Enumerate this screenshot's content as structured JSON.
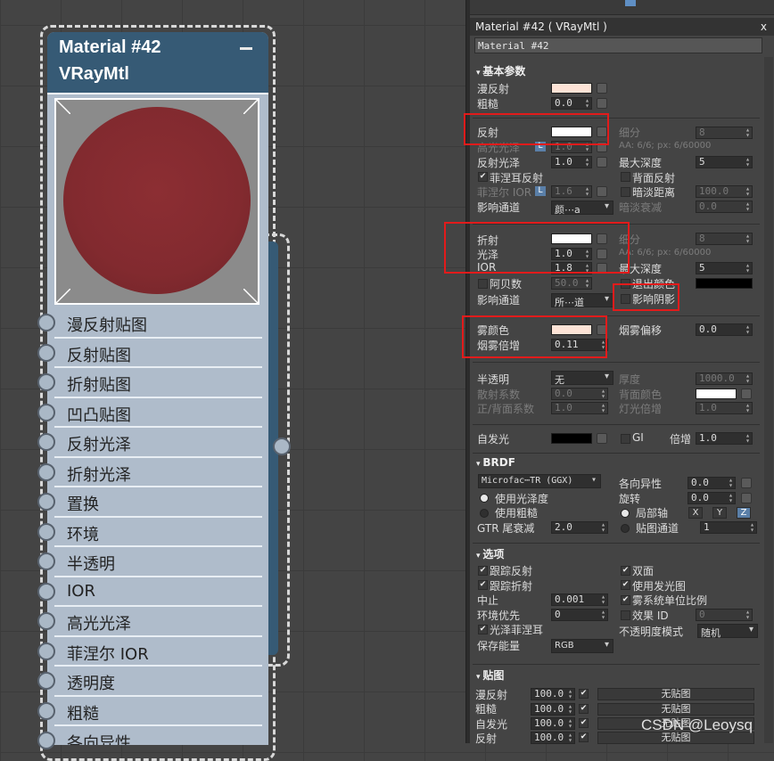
{
  "node": {
    "title_line1": "Material #42",
    "title_line2": "VRayMtl",
    "slots": [
      "漫反射贴图",
      "反射贴图",
      "折射贴图",
      "凹凸贴图",
      "反射光泽",
      "折射光泽",
      "置换",
      "环境",
      "半透明",
      "IOR",
      "高光光泽",
      "菲涅尔 IOR",
      "透明度",
      "粗糙",
      "各向异性"
    ]
  },
  "panel": {
    "title": "Material #42  ( VRayMtl )",
    "close": "x",
    "name_value": "Material #42",
    "basic": {
      "header": "基本参数",
      "diffuse": "漫反射",
      "rough": "粗糙",
      "rough_val": "0.0",
      "reflect": "反射",
      "subdiv": "细分",
      "subdiv_val": "8",
      "aa": "AA: 6/6; px: 6/60000",
      "hilight_gloss": "高光光泽",
      "hilight_val": "1.0",
      "refl_gloss": "反射光泽",
      "refl_gloss_val": "1.0",
      "max_depth": "最大深度",
      "max_depth_val": "5",
      "fresnel": "菲涅耳反射",
      "back_reflect": "背面反射",
      "fresnel_ior": "菲涅尔 IOR",
      "fresnel_ior_val": "1.6",
      "dim_dist": "暗淡距离",
      "dim_dist_val": "100.0",
      "affect_channel": "影响通道",
      "affect_channel_val": "颜⋯a",
      "dim_falloff": "暗淡衰减",
      "dim_falloff_val": "0.0",
      "refract": "折射",
      "refr_subdiv": "细分",
      "refr_subdiv_val": "8",
      "refr_aa": "AA: 6/6; px: 6/60000",
      "gloss": "光泽",
      "gloss_val": "1.0",
      "ior": "IOR",
      "ior_val": "1.8",
      "refr_max_depth": "最大深度",
      "refr_max_depth_val": "5",
      "abbe": "阿贝数",
      "abbe_val": "50.0",
      "exit_color": "退出颜色",
      "refr_affect": "影响通道",
      "refr_affect_val": "所⋯道",
      "affect_shadow": "影响阴影",
      "fog_color": "雾颜色",
      "fog_bias": "烟雾偏移",
      "fog_bias_val": "0.0",
      "fog_mult": "烟雾倍增",
      "fog_mult_val": "0.11",
      "translucency": "半透明",
      "translucency_val": "无",
      "thickness": "厚度",
      "thickness_val": "1000.0",
      "scatter": "散射系数",
      "scatter_val": "0.0",
      "back_color": "背面颜色",
      "fb_coef": "正/背面系数",
      "fb_coef_val": "1.0",
      "light_mult": "灯光倍增",
      "light_mult_val": "1.0",
      "self_illum": "自发光",
      "gi": "GI",
      "mult": "倍增",
      "mult_val": "1.0"
    },
    "brdf": {
      "header": "BRDF",
      "type_val": "Microfac⋯TR (GGX)",
      "anisotropy": "各向异性",
      "anisotropy_val": "0.0",
      "use_gloss": "使用光泽度",
      "rotation": "旋转",
      "rotation_val": "0.0",
      "use_rough": "使用粗糙",
      "local_axis": "局部轴",
      "ax_x": "X",
      "ax_y": "Y",
      "ax_z": "Z",
      "gtr": "GTR 尾衰减",
      "gtr_val": "2.0",
      "map_channel": "贴图通道",
      "map_channel_val": "1"
    },
    "options": {
      "header": "选项",
      "trace_refl": "跟踪反射",
      "double_sided": "双面",
      "trace_refr": "跟踪折射",
      "use_illum_map": "使用发光图",
      "cutoff": "中止",
      "cutoff_val": "0.001",
      "fog_units": "雾系统单位比例",
      "env_priority": "环境优先",
      "env_priority_val": "0",
      "effect_id": "效果 ID",
      "effect_id_val": "0",
      "gloss_fresnel": "光泽菲涅耳",
      "opacity_mode": "不透明度模式",
      "opacity_mode_val": "随机",
      "preserve_energy": "保存能量",
      "preserve_energy_val": "RGB"
    },
    "maps": {
      "header": "贴图",
      "rows": [
        {
          "label": "漫反射",
          "val": "100.0",
          "map": "无贴图"
        },
        {
          "label": "粗糙",
          "val": "100.0",
          "map": "无贴图"
        },
        {
          "label": "自发光",
          "val": "100.0",
          "map": "无贴图"
        },
        {
          "label": "反射",
          "val": "100.0",
          "map": "无贴图"
        }
      ]
    }
  },
  "watermark": "CSDN @Leoysq",
  "colors": {
    "diffuse_swatch": "#fde3d6",
    "reflect_swatch": "#ffffff",
    "refract_swatch": "#ffffff",
    "fog_swatch": "#fde3d6",
    "exit_swatch": "#000000",
    "self_illum_swatch": "#000000",
    "back_color_swatch": "#ffffff",
    "highlight_box": "#e21b1b",
    "node_header": "#365a75"
  }
}
